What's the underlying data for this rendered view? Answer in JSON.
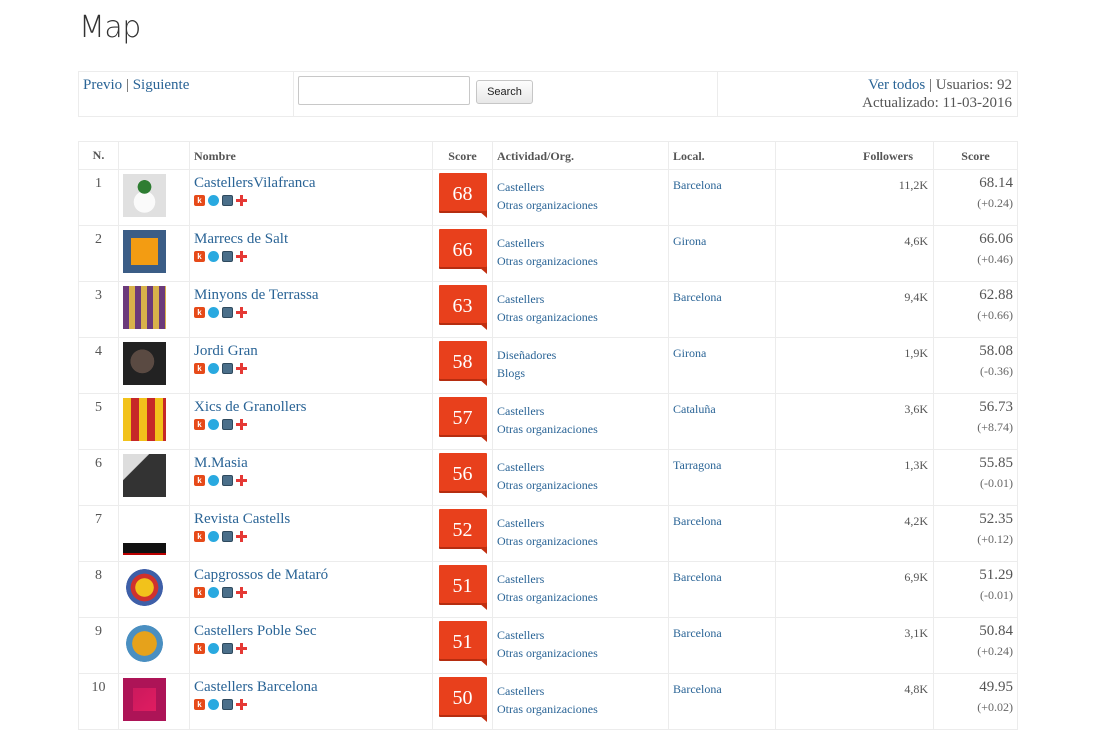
{
  "page": {
    "title": "Map"
  },
  "nav": {
    "prev_label": "Previo",
    "separator": "|",
    "next_label": "Siguiente"
  },
  "search": {
    "value": "",
    "placeholder": "",
    "button_label": "Search"
  },
  "stats": {
    "view_all_label": "Ver todos",
    "separator": "|",
    "users_label": "Usuarios: 92",
    "updated_label": "Actualizado: 11-03-2016"
  },
  "table": {
    "headers": {
      "n": "N.",
      "avatar": "",
      "name": "Nombre",
      "badge": "Score",
      "category": "Actividad/Org.",
      "location": "Local.",
      "followers": "Followers",
      "score": "Score"
    },
    "rows": [
      {
        "n": "1",
        "name": "CastellersVilafranca",
        "badge": "68",
        "cat1": "Castellers",
        "cat2": "Otras organizaciones",
        "location": "Barcelona",
        "followers": "11,2K",
        "score": "68.14",
        "delta": "(+0.24)"
      },
      {
        "n": "2",
        "name": "Marrecs de Salt",
        "badge": "66",
        "cat1": "Castellers",
        "cat2": "Otras organizaciones",
        "location": "Girona",
        "followers": "4,6K",
        "score": "66.06",
        "delta": "(+0.46)"
      },
      {
        "n": "3",
        "name": "Minyons de Terrassa",
        "badge": "63",
        "cat1": "Castellers",
        "cat2": "Otras organizaciones",
        "location": "Barcelona",
        "followers": "9,4K",
        "score": "62.88",
        "delta": "(+0.66)"
      },
      {
        "n": "4",
        "name": "Jordi Gran",
        "badge": "58",
        "cat1": "Diseñadores",
        "cat2": "Blogs",
        "location": "Girona",
        "followers": "1,9K",
        "score": "58.08",
        "delta": "(-0.36)"
      },
      {
        "n": "5",
        "name": "Xics de Granollers",
        "badge": "57",
        "cat1": "Castellers",
        "cat2": "Otras organizaciones",
        "location": "Cataluña",
        "followers": "3,6K",
        "score": "56.73",
        "delta": "(+8.74)"
      },
      {
        "n": "6",
        "name": "M.Masia",
        "badge": "56",
        "cat1": "Castellers",
        "cat2": "Otras organizaciones",
        "location": "Tarragona",
        "followers": "1,3K",
        "score": "55.85",
        "delta": "(-0.01)"
      },
      {
        "n": "7",
        "name": "Revista Castells",
        "badge": "52",
        "cat1": "Castellers",
        "cat2": "Otras organizaciones",
        "location": "Barcelona",
        "followers": "4,2K",
        "score": "52.35",
        "delta": "(+0.12)"
      },
      {
        "n": "8",
        "name": "Capgrossos de Mataró",
        "badge": "51",
        "cat1": "Castellers",
        "cat2": "Otras organizaciones",
        "location": "Barcelona",
        "followers": "6,9K",
        "score": "51.29",
        "delta": "(-0.01)"
      },
      {
        "n": "9",
        "name": "Castellers Poble Sec",
        "badge": "51",
        "cat1": "Castellers",
        "cat2": "Otras organizaciones",
        "location": "Barcelona",
        "followers": "3,1K",
        "score": "50.84",
        "delta": "(+0.24)"
      },
      {
        "n": "10",
        "name": "Castellers Barcelona",
        "badge": "50",
        "cat1": "Castellers",
        "cat2": "Otras organizaciones",
        "location": "Barcelona",
        "followers": "4,8K",
        "score": "49.95",
        "delta": "(+0.02)"
      }
    ]
  },
  "colors": {
    "link": "#2a6496",
    "badge": "#e8401c",
    "border": "#ececec"
  },
  "social_icons": [
    "klout-icon",
    "twitter-icon",
    "instagram-icon",
    "google-plus-icon"
  ]
}
